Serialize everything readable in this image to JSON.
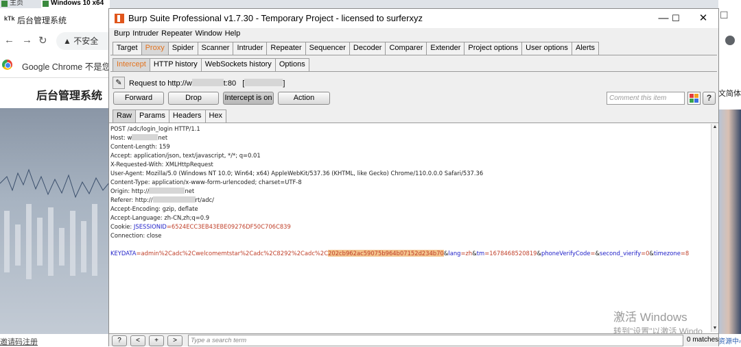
{
  "browser": {
    "tab1": "主页",
    "tab2": "Windows 10 x64",
    "page_tab_title": "后台管理系统",
    "logo": "kTk",
    "insecure_label": "不安全",
    "info_bar": "Google Chrome 不是您",
    "page_heading": "后台管理系统",
    "footer_link": "邀请码注册",
    "lang_switch": "文简体",
    "bottom_right_link": "资源中心"
  },
  "burp": {
    "title": "Burp Suite Professional v1.7.30 - Temporary Project - licensed to surferxyz",
    "window_controls": {
      "minimize": "—",
      "maximize": "☐",
      "close": "✕"
    },
    "menu": [
      "Burp",
      "Intruder",
      "Repeater",
      "Window",
      "Help"
    ],
    "main_tabs": [
      "Target",
      "Proxy",
      "Spider",
      "Scanner",
      "Intruder",
      "Repeater",
      "Sequencer",
      "Decoder",
      "Comparer",
      "Extender",
      "Project options",
      "User options",
      "Alerts"
    ],
    "active_main_tab": "Proxy",
    "proxy_tabs": [
      "Intercept",
      "HTTP history",
      "WebSockets history",
      "Options"
    ],
    "active_proxy_tab": "Intercept",
    "request_to_prefix": "Request to http://w",
    "request_to_suffix": "t:80",
    "request_bracket_open": "[",
    "request_bracket_close": "]",
    "buttons": {
      "forward": "Forward",
      "drop": "Drop",
      "intercept": "Intercept is on",
      "action": "Action"
    },
    "comment_placeholder": "Comment this item",
    "help_label": "?",
    "view_tabs": [
      "Raw",
      "Params",
      "Headers",
      "Hex"
    ],
    "active_view_tab": "Raw",
    "request": {
      "request_line": "POST /adc/login_login HTTP/1.1",
      "host_prefix": "Host: w",
      "host_suffix": "net",
      "content_length": "Content-Length: 159",
      "accept": "Accept: application/json, text/javascript, */*; q=0.01",
      "x_requested_with": "X-Requested-With: XMLHttpRequest",
      "user_agent": "User-Agent: Mozilla/5.0 (Windows NT 10.0; Win64; x64) AppleWebKit/537.36 (KHTML, like Gecko) Chrome/110.0.0.0 Safari/537.36",
      "content_type": "Content-Type: application/x-www-form-urlencoded; charset=UTF-8",
      "origin_prefix": "Origin: http://",
      "origin_suffix": "net",
      "referer_prefix": "Referer: http://",
      "referer_suffix": "rt/adc/",
      "accept_encoding": "Accept-Encoding: gzip, deflate",
      "accept_language": "Accept-Language: zh-CN,zh;q=0.9",
      "cookie_label": "Cookie: ",
      "cookie_name": "JSESSIONID",
      "cookie_eq": "=",
      "cookie_value": "6524ECC3EB43EBE09276DF50C706C839",
      "connection": "Connection: close",
      "body": {
        "keydata_name": "KEYDATA",
        "keydata_value_a": "=admin%2Cadc%2Cwelcomemtstar%2Cadc%2C8292%2Cadc%2C",
        "keydata_value_hl": "202cb962ac59075b964b07152d234b70",
        "amp1": "&",
        "lang_name": "lang",
        "lang_value": "=zh",
        "amp2": "&",
        "tm_name": "tm",
        "tm_value": "=1678468520819",
        "amp3": "&",
        "phone_name": "phoneVerifyCode",
        "phone_value": "=",
        "amp4": "&",
        "verify_name": "second_vierify",
        "verify_value": "=0",
        "amp5": "&",
        "tz_name": "timezone",
        "tz_value": "=8"
      }
    },
    "search": {
      "help": "?",
      "prev": "<",
      "add": "+",
      "next": ">",
      "placeholder": "Type a search term",
      "matches": "0 matches"
    }
  },
  "watermark": {
    "line1": "激活 Windows",
    "line2": "转到\"设置\"以激活 Windo"
  },
  "colors": {
    "proxy_active": "#e3721d",
    "param_name": "#2020c8",
    "param_value": "#c0402a",
    "highlight": "#f3c48d"
  }
}
